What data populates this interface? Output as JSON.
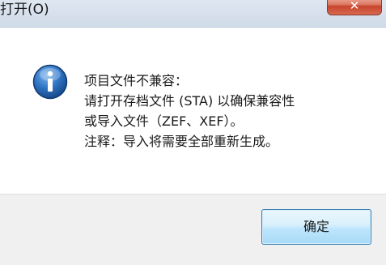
{
  "window": {
    "title": "打开(O)",
    "close_glyph": "✕"
  },
  "message": {
    "lines": [
      "项目文件不兼容：",
      "请打开存档文件 (STA) 以确保兼容性",
      "或导入文件（ZEF、XEF）。",
      "注释：导入将需要全部重新生成。"
    ],
    "icon": "information-icon"
  },
  "buttons": {
    "ok_label": "确定"
  },
  "colors": {
    "titlebar": "#d6e0ec",
    "close_button": "#c8452e",
    "footer": "#f0f0f0",
    "info_icon": "#1f5fa8",
    "ok_button_border": "#3c7fb1"
  }
}
